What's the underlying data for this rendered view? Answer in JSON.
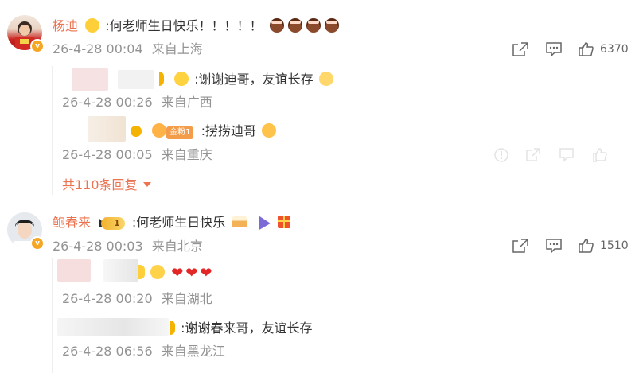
{
  "comments": [
    {
      "author": "杨迪",
      "text": ":何老师生日快乐！！！！！",
      "time": "26-4-28 00:04",
      "location": "来自上海",
      "likes": "6370",
      "replies": [
        {
          "text": ":谢谢迪哥，友谊长存",
          "time": "26-4-28 00:26",
          "location": "来自广西"
        },
        {
          "fan_badge": "金粉1",
          "text": ":捞捞迪哥",
          "time": "26-4-28 00:05",
          "location": "来自重庆"
        }
      ],
      "more_replies": "共110条回复"
    },
    {
      "author": "鲍春来",
      "rank_badge": "1",
      "text": ":何老师生日快乐",
      "time": "26-4-28 00:03",
      "location": "来自北京",
      "likes": "1510",
      "replies": [
        {
          "time": "26-4-28 00:20",
          "location": "来自湖北"
        },
        {
          "text": ":谢谢春来哥，友谊长存",
          "time": "26-4-28 06:56",
          "location": "来自黑龙江"
        }
      ]
    }
  ],
  "icons": {
    "share": "share-icon",
    "comment": "comment-icon",
    "like": "thumbs-up-icon",
    "verified": "verified-v-icon"
  },
  "colors": {
    "name": "#eb7350",
    "meta": "#939393",
    "text": "#333333",
    "heart": "#e32626"
  }
}
